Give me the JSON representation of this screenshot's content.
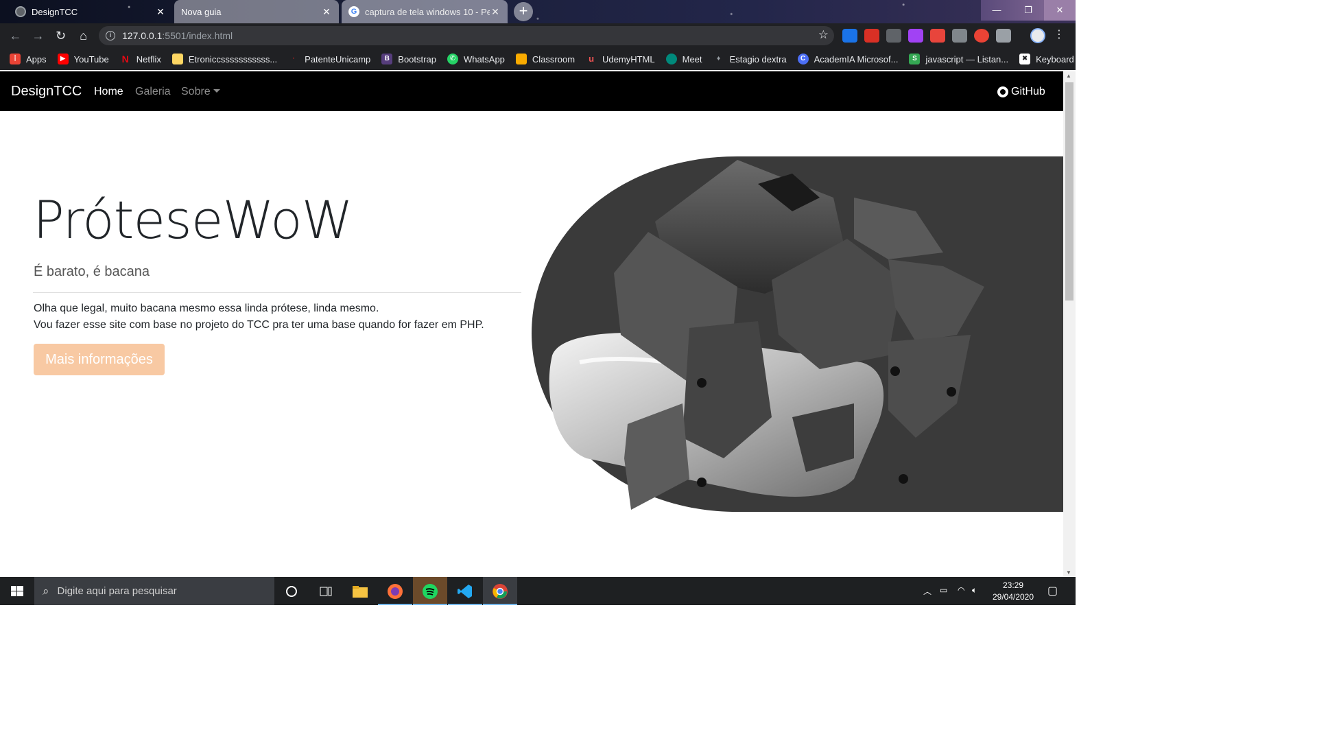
{
  "browser": {
    "tabs": [
      {
        "title": "DesignTCC",
        "close": "✕"
      },
      {
        "title": "Nova guia",
        "close": "✕"
      },
      {
        "title": "captura de tela windows 10 - Pe",
        "close": "✕"
      }
    ],
    "new_tab": "+",
    "window_controls": {
      "minimize": "—",
      "maximize": "❐",
      "close": "✕"
    },
    "url_host": "127.0.0.1",
    "url_path": ":5501/index.html",
    "bookmarks": [
      {
        "label": "Apps",
        "color": "#ea4335"
      },
      {
        "label": "YouTube",
        "color": "#ff0000"
      },
      {
        "label": "Netflix",
        "color": "#e50914"
      },
      {
        "label": "Etroniccsssssssssss...",
        "color": "#fdd663"
      },
      {
        "label": "PatenteUnicamp",
        "color": "#c5221f"
      },
      {
        "label": "Bootstrap",
        "color": "#563d7c"
      },
      {
        "label": "WhatsApp",
        "color": "#25d366"
      },
      {
        "label": "Classroom",
        "color": "#f9ab00"
      },
      {
        "label": "UdemyHTML",
        "color": "#ec5252"
      },
      {
        "label": "Meet",
        "color": "#00897b"
      },
      {
        "label": "Estagio dextra",
        "color": "#9aa0a6"
      },
      {
        "label": "AcademIA Microsof...",
        "color": "#4c6ef5"
      },
      {
        "label": "javascript — Listan...",
        "color": "#34a853"
      },
      {
        "label": "Keyboard",
        "color": "#5f6368"
      }
    ]
  },
  "site": {
    "brand": "DesignTCC",
    "nav": {
      "home": "Home",
      "galeria": "Galeria",
      "sobre": "Sobre"
    },
    "github": "GitHub",
    "hero": {
      "title": "PróteseWoW",
      "lead": "É barato, é bacana",
      "text_line1": "Olha que legal, muito bacana mesmo essa linda prótese, linda mesmo.",
      "text_line2": "Vou fazer esse site com base no projeto do TCC pra ter uma base quando for fazer em PHP.",
      "button": "Mais informações"
    },
    "colors": {
      "navbar": "#000000",
      "button": "#f8c9a3",
      "image_bg": "#3a3a3a"
    }
  },
  "taskbar": {
    "search_placeholder": "Digite aqui para pesquisar",
    "time": "23:29",
    "date": "29/04/2020"
  }
}
